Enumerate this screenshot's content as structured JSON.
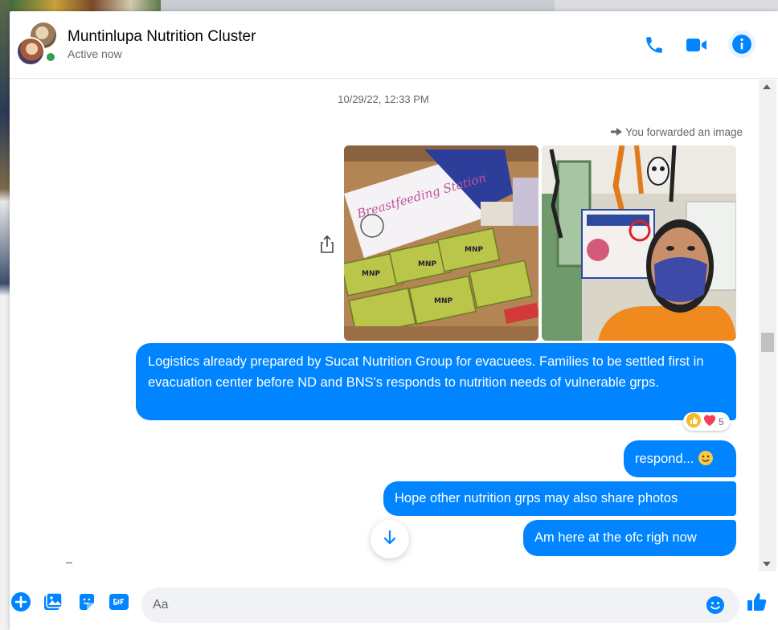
{
  "conversation": {
    "title": "Muntinlupa Nutrition Cluster",
    "status": "Active now"
  },
  "header_icons": [
    "phone-icon",
    "video-camera-icon",
    "info-icon"
  ],
  "messages": {
    "timestamp": "10/29/22, 12:33 PM",
    "forward_note": "You forwarded an image",
    "bubbles": [
      {
        "text": "Logistics already prepared by Sucat Nutrition Group for evacuees. Families to be settled first in evacuation center before ND and BNS's responds to nutrition needs of vulnerable grps."
      },
      {
        "text": "respond... "
      },
      {
        "text": "Hope other nutrition grps may also share photos"
      },
      {
        "text": "Am here at the ofc righ now"
      }
    ],
    "reaction_count": "5",
    "photo_sign_text": "Breastfeeding Station",
    "photo_box_text": "MNP"
  },
  "composer": {
    "placeholder": "Aa"
  },
  "colors": {
    "accent": "#0084ff",
    "online": "#31a24c"
  }
}
